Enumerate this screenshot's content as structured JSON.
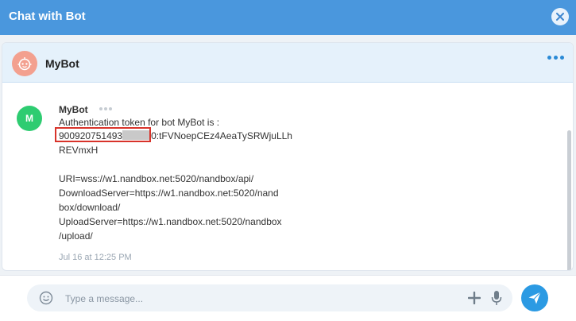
{
  "window": {
    "title": "Chat with Bot"
  },
  "chat": {
    "bot_name": "MyBot"
  },
  "message": {
    "avatar_letter": "M",
    "sender": "MyBot",
    "line1": "Authentication token for bot MyBot is :",
    "token_visible": "900920751493",
    "token_rest": "0:tFVNoepCEz4AeaTySRWjuLLh",
    "line3": "REVmxH",
    "line5": "URI=wss://w1.nandbox.net:5020/nandbox/api/",
    "line6": "DownloadServer=https://w1.nandbox.net:5020/nand",
    "line7": "box/download/",
    "line8": "UploadServer=https://w1.nandbox.net:5020/nandbox",
    "line9": "/upload/",
    "timestamp": "Jul 16 at 12:25 PM"
  },
  "composer": {
    "placeholder": "Type a message..."
  },
  "colors": {
    "titlebar": "#4a97dd",
    "header_bg": "#e5f1fb",
    "avatar_bot": "#f3a08f",
    "avatar_msg": "#2ecc71",
    "highlight": "#d8332a",
    "send_button": "#2b9ae3"
  },
  "icons": {
    "close": "close-icon",
    "bot_avatar": "robot-icon",
    "header_more": "more-dots-icon",
    "message_more": "more-dots-icon",
    "emoji": "smiley-icon",
    "attach": "plus-icon",
    "mic": "microphone-icon",
    "send": "paper-plane-icon"
  }
}
